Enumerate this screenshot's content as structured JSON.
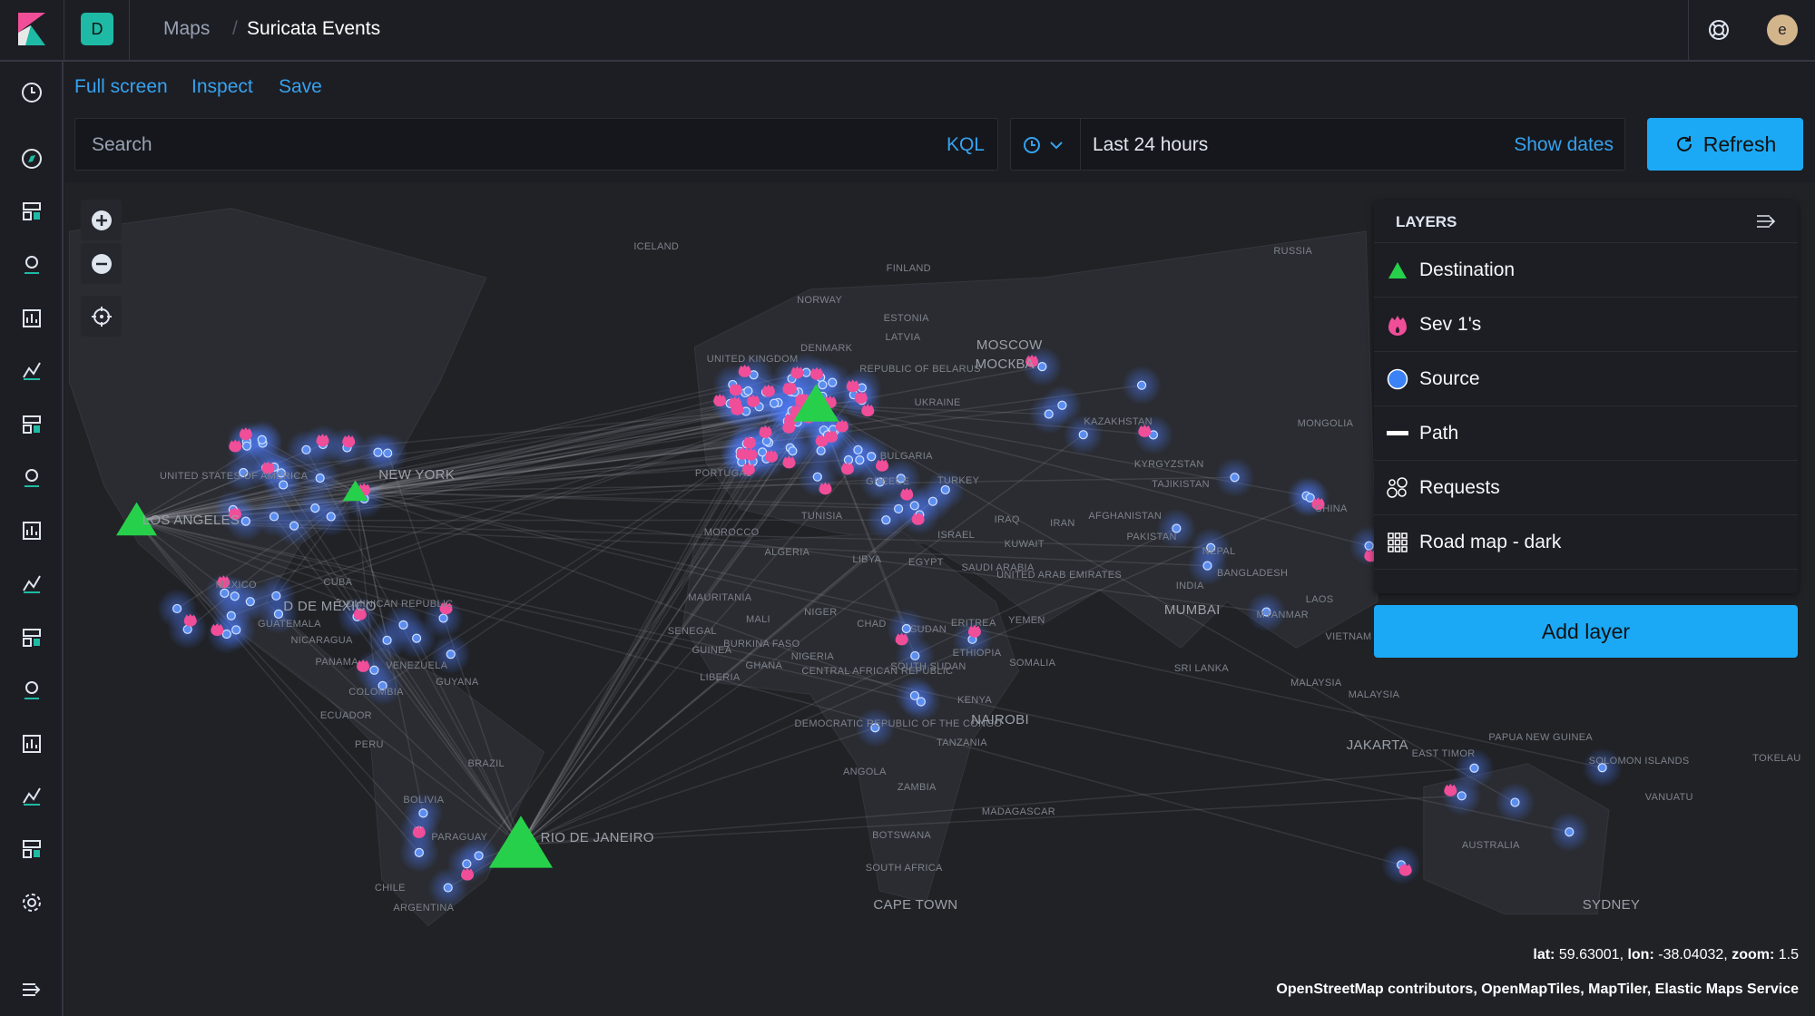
{
  "header": {
    "space_initial": "D",
    "breadcrumbs": [
      "Maps",
      "Suricata Events"
    ],
    "avatar_initial": "e"
  },
  "toolbar": {
    "full_screen": "Full screen",
    "inspect": "Inspect",
    "save": "Save"
  },
  "query": {
    "search_placeholder": "Search",
    "language": "KQL",
    "time_range": "Last 24 hours",
    "show_dates": "Show dates",
    "refresh": "Refresh"
  },
  "layers": {
    "title": "LAYERS",
    "items": [
      {
        "label": "Destination",
        "icon": "triangle-icon",
        "color": "#27d04a"
      },
      {
        "label": "Sev 1's",
        "icon": "fire-icon",
        "color": "#f04e98"
      },
      {
        "label": "Source",
        "icon": "circle-icon",
        "color": "#3b82f6"
      },
      {
        "label": "Path",
        "icon": "line-icon",
        "color": "#ffffff"
      },
      {
        "label": "Requests",
        "icon": "clusters-icon",
        "color": "#ffffff"
      },
      {
        "label": "Road map - dark",
        "icon": "grid-icon",
        "color": "#ffffff"
      }
    ],
    "add_layer": "Add layer"
  },
  "map": {
    "coords": {
      "lat_label": "lat:",
      "lat": "59.63001",
      "lon_label": "lon:",
      "lon": "-38.04032",
      "zoom_label": "zoom:",
      "zoom": "1.5"
    },
    "attribution": "OpenStreetMap contributors, OpenMapTiles, MapTiler, Elastic Maps Service",
    "labels": [
      "Iceland",
      "Finland",
      "Norway",
      "Russia",
      "Estonia",
      "Latvia",
      "Moscow",
      "Москва",
      "Republic of Belarus",
      "Ukraine",
      "Kazakhstan",
      "Mongolia",
      "Kyrgyzstan",
      "Tajikistan",
      "China",
      "Afghanistan",
      "Pakistan",
      "Iraq",
      "Iran",
      "Kuwait",
      "Nepal",
      "Bangladesh",
      "Saudi Arabia",
      "United Arab Emirates",
      "India",
      "Mumbai",
      "Myanmar",
      "Bulgaria",
      "Greece",
      "Turkey",
      "Israel",
      "Tunisia",
      "Morocco",
      "Algeria",
      "Libya",
      "Egypt",
      "Mauritania",
      "Mali",
      "Niger",
      "Chad",
      "Sudan",
      "Eritrea",
      "Yemen",
      "Senegal",
      "Burkina Faso",
      "Guinea",
      "Ghana",
      "Nigeria",
      "Central African Republic",
      "South Sudan",
      "Ethiopia",
      "Somalia",
      "Liberia",
      "Democratic Republic of the Congo",
      "Kenya",
      "Nairobi",
      "Tanzania",
      "Angola",
      "Zambia",
      "Madagascar",
      "Botswana",
      "South Africa",
      "Cape Town",
      "United States of America",
      "New York",
      "Los Angeles",
      "Mexico",
      "Cuba",
      "Dominican Republic",
      "D de México",
      "Guatemala",
      "Nicaragua",
      "Panama",
      "Venezuela",
      "Guyana",
      "Colombia",
      "Ecuador",
      "Peru",
      "Brazil",
      "Bolivia",
      "Paraguay",
      "Rio de Janeiro",
      "Chile",
      "Argentina",
      "Sri Lanka",
      "Malaysia",
      "Vietnam",
      "Jakarta",
      "East Timor",
      "Papua New Guinea",
      "Solomon Islands",
      "Tokelau",
      "Vanuatu",
      "Australia",
      "Sydney",
      "United Kingdom",
      "Denmark",
      "Portugal",
      "Laos",
      "Malaysia"
    ]
  },
  "colors": {
    "accent": "#1ba9f5",
    "link": "#36a2ef",
    "destination": "#27d04a",
    "sev1": "#f04e98",
    "source": "#4d8cf0"
  }
}
